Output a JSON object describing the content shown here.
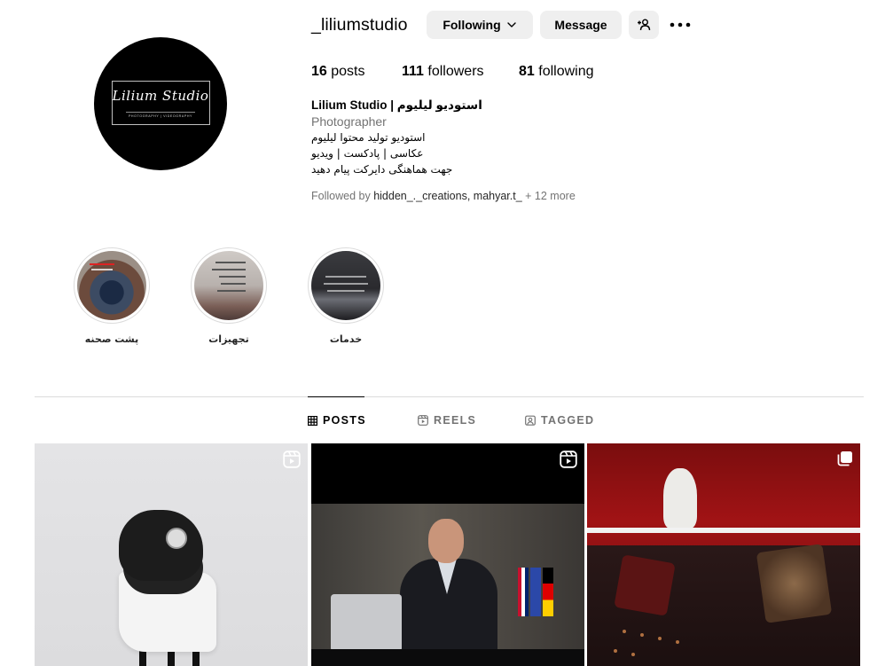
{
  "profile": {
    "username": "_liliumstudio",
    "avatar": {
      "logo_name": "Lilium Studio",
      "logo_sub": "PHOTOGRAPHY | VIDEOGRAPHY"
    },
    "buttons": {
      "following": "Following",
      "message": "Message"
    },
    "stats": {
      "posts_count": "16",
      "posts_label": "posts",
      "followers_count": "111",
      "followers_label": "followers",
      "following_count": "81",
      "following_label": "following"
    },
    "bio": {
      "name": "Lilium Studio | استودیو لیلیوم",
      "category": "Photographer",
      "lines": [
        "استودیو تولید محتوا لیلیوم",
        "عکاسی | پادکست | ویدیو",
        "جهت هماهنگی دایرکت پیام دهید"
      ]
    },
    "followed_by": {
      "prefix": "Followed by ",
      "account1": "hidden_._creations",
      "sep": ", ",
      "account2": "mahyar.t_",
      "more": " + 12 more"
    }
  },
  "highlights": [
    {
      "label": "پشت صحنه"
    },
    {
      "label": "تجهیزات"
    },
    {
      "label": "خدمات"
    }
  ],
  "tabs": [
    {
      "label": "POSTS",
      "icon": "grid-icon",
      "active": true
    },
    {
      "label": "REELS",
      "icon": "reels-icon",
      "active": false
    },
    {
      "label": "TAGGED",
      "icon": "tagged-icon",
      "active": false
    }
  ],
  "posts": [
    {
      "type": "reel",
      "icon": "reels-icon"
    },
    {
      "type": "reel",
      "icon": "reels-icon"
    },
    {
      "type": "carousel",
      "icon": "carousel-icon"
    }
  ],
  "colors": {
    "button_bg": "#efefef",
    "secondary_text": "#737373",
    "divider": "#dbdbdb"
  }
}
